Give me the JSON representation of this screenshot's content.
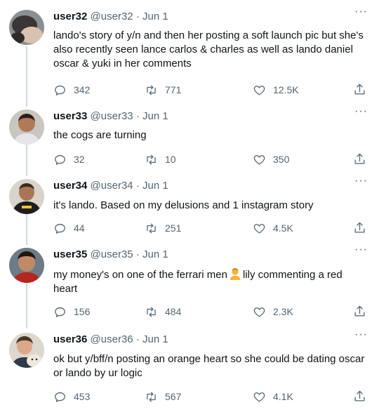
{
  "tweets": [
    {
      "name": "user32",
      "handle": "@user32",
      "dot": "·",
      "date": "Jun 1",
      "text": "lando's story of y/n and then her posting a soft launch pic but she's also recently seen lance carlos & charles as well as lando daniel oscar & yuki in her comments",
      "replies": "342",
      "retweets": "771",
      "likes": "12.5K"
    },
    {
      "name": "user33",
      "handle": "@user33",
      "dot": "·",
      "date": "Jun 1",
      "text": "the cogs are turning",
      "replies": "32",
      "retweets": "10",
      "likes": "350"
    },
    {
      "name": "user34",
      "handle": "@user34",
      "dot": "·",
      "date": "Jun 1",
      "text": "it's lando. Based on my delusions and 1 instagram story",
      "replies": "44",
      "retweets": "251",
      "likes": "4.5K"
    },
    {
      "name": "user35",
      "handle": "@user35",
      "dot": "·",
      "date": "Jun 1",
      "text_before": "my money's on one of the ferrari men",
      "text_after": "lily commenting a red heart",
      "replies": "156",
      "retweets": "484",
      "likes": "2.3K"
    },
    {
      "name": "user36",
      "handle": "@user36",
      "dot": "·",
      "date": "Jun 1",
      "text": "ok but y/bff/n posting an orange heart so she could be dating oscar or lando by ur logic",
      "replies": "453",
      "retweets": "567",
      "likes": "4.1K"
    }
  ],
  "more_label": "···",
  "icons": {
    "reply": "reply-icon",
    "retweet": "retweet-icon",
    "like": "heart-icon",
    "share": "share-icon",
    "emoji": "person-emoji-icon"
  },
  "colors": {
    "text": "#0f1419",
    "secondary": "#536471",
    "thread_line": "#cfd9de",
    "emoji": "#f4b63a"
  }
}
